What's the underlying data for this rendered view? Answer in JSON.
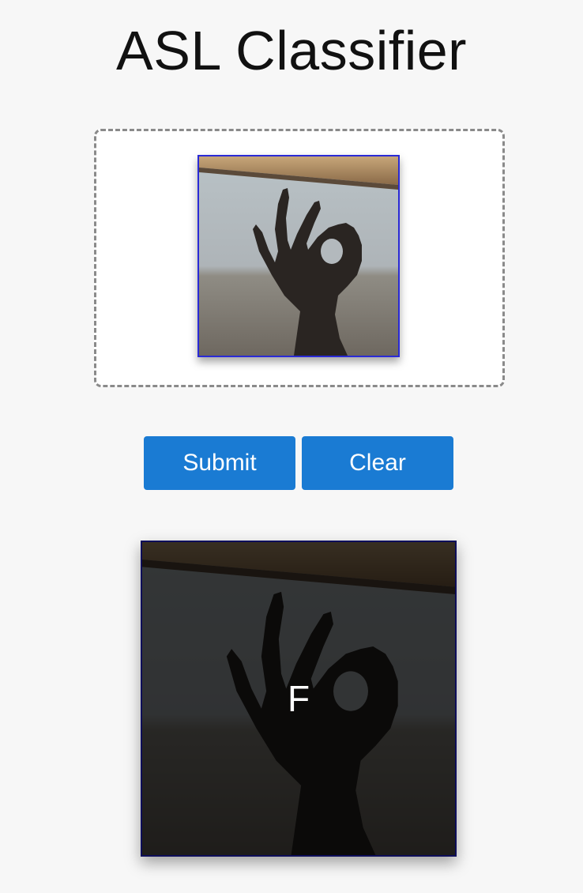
{
  "header": {
    "title": "ASL Classifier"
  },
  "upload": {
    "image_subject": "hand-sign-photo"
  },
  "actions": {
    "submit_label": "Submit",
    "clear_label": "Clear"
  },
  "result": {
    "prediction": "F"
  },
  "colors": {
    "page_background": "#f7f7f7",
    "button_background": "#1a7bd3",
    "button_text": "#ffffff",
    "thumbnail_border": "#2a2ad6",
    "result_border": "#0e0e5a"
  }
}
